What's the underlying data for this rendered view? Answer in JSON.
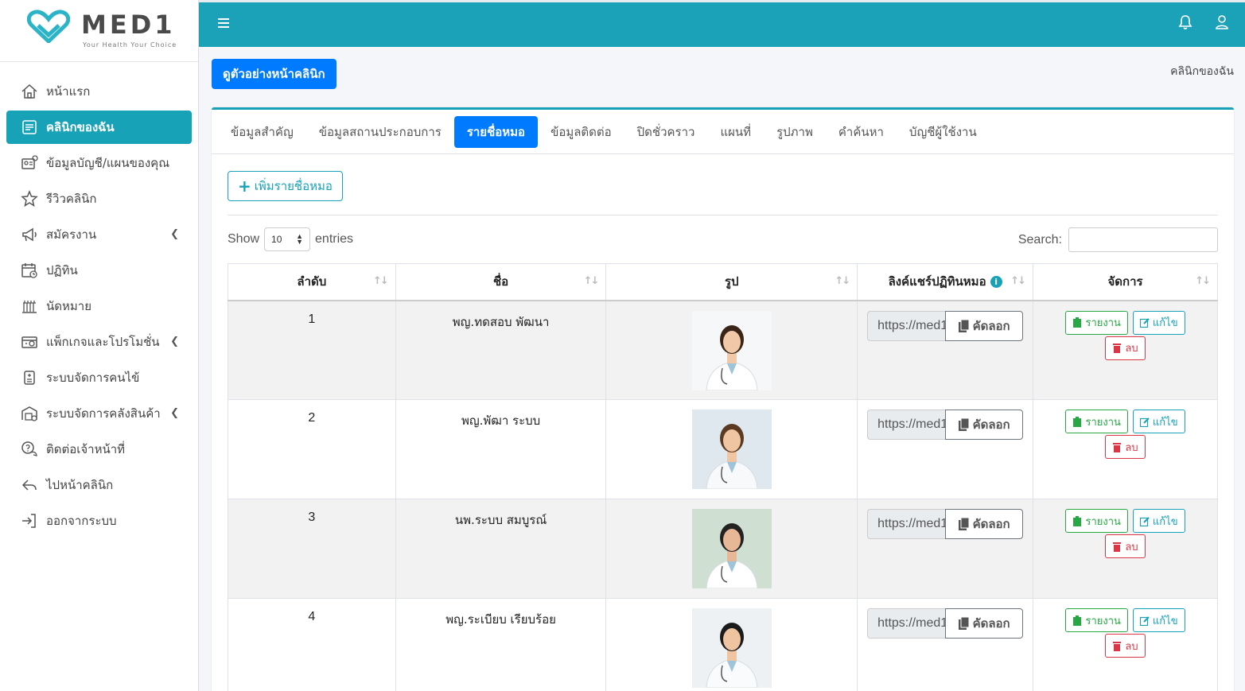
{
  "brand": {
    "name": "MED1",
    "tagline": "Your Health Your Choice"
  },
  "sidebar": {
    "items": [
      {
        "label": "หน้าแรก",
        "icon": "home-icon",
        "active": false,
        "has_submenu": false
      },
      {
        "label": "คลินิกของฉัน",
        "icon": "clinic-list-icon",
        "active": true,
        "has_submenu": false
      },
      {
        "label": "ข้อมูลบัญชี/แผนของคุณ",
        "icon": "account-card-icon",
        "active": false,
        "has_submenu": false
      },
      {
        "label": "รีวิวคลินิก",
        "icon": "star-icon",
        "active": false,
        "has_submenu": false
      },
      {
        "label": "สมัครงาน",
        "icon": "megaphone-icon",
        "active": false,
        "has_submenu": true
      },
      {
        "label": "ปฏิทิน",
        "icon": "calendar-icon",
        "active": false,
        "has_submenu": false
      },
      {
        "label": "นัดหมาย",
        "icon": "appointment-icon",
        "active": false,
        "has_submenu": false
      },
      {
        "label": "แพ็กเกจและโปรโมชั่น",
        "icon": "package-icon",
        "active": false,
        "has_submenu": true
      },
      {
        "label": "ระบบจัดการคนไข้",
        "icon": "patient-icon",
        "active": false,
        "has_submenu": false
      },
      {
        "label": "ระบบจัดการคลังสินค้า",
        "icon": "warehouse-icon",
        "active": false,
        "has_submenu": true
      },
      {
        "label": "ติดต่อเจ้าหน้าที่",
        "icon": "contact-icon",
        "active": false,
        "has_submenu": false
      },
      {
        "label": "ไปหน้าคลินิก",
        "icon": "back-arrow-icon",
        "active": false,
        "has_submenu": false
      },
      {
        "label": "ออกจากระบบ",
        "icon": "logout-icon",
        "active": false,
        "has_submenu": false
      }
    ]
  },
  "header": {
    "preview_button": "ดูตัวอย่างหน้าคลินิก",
    "breadcrumb": "คลินิกของฉัน"
  },
  "tabs": [
    {
      "label": "ข้อมูลสำคัญ",
      "active": false
    },
    {
      "label": "ข้อมูลสถานประกอบการ",
      "active": false
    },
    {
      "label": "รายชื่อหมอ",
      "active": true
    },
    {
      "label": "ข้อมูลติดต่อ",
      "active": false
    },
    {
      "label": "ปิดชั่วคราว",
      "active": false
    },
    {
      "label": "แผนที่",
      "active": false
    },
    {
      "label": "รูปภาพ",
      "active": false
    },
    {
      "label": "คำค้นหา",
      "active": false
    },
    {
      "label": "บัญชีผู้ใช้งาน",
      "active": false
    }
  ],
  "add_button": "เพิ่มรายชื่อหมอ",
  "table_controls": {
    "show": "Show",
    "entries_value": "10",
    "entries": "entries",
    "search": "Search:"
  },
  "table": {
    "columns": [
      "ลำดับ",
      "ชื่อ",
      "รูป",
      "ลิงค์แชร์ปฏิทินหมอ",
      "จัดการ"
    ],
    "rows": [
      {
        "no": "1",
        "name": "พญ.ทดสอบ พัฒนา",
        "link": "https://med1",
        "copy": "คัดลอก"
      },
      {
        "no": "2",
        "name": "พญ.พัฒา ระบบ",
        "link": "https://med1",
        "copy": "คัดลอก"
      },
      {
        "no": "3",
        "name": "นพ.ระบบ สมบูรณ์",
        "link": "https://med1",
        "copy": "คัดลอก"
      },
      {
        "no": "4",
        "name": "พญ.ระเบียบ เรียบร้อย",
        "link": "https://med1",
        "copy": "คัดลอก"
      }
    ],
    "actions": {
      "report": "รายงาน",
      "edit": "แก้ไข",
      "delete": "ลบ"
    }
  },
  "colors": {
    "topbar": "#1ba1b8",
    "primary": "#007bff",
    "info": "#17a2b8",
    "success": "#28a745",
    "danger": "#dc3545"
  }
}
